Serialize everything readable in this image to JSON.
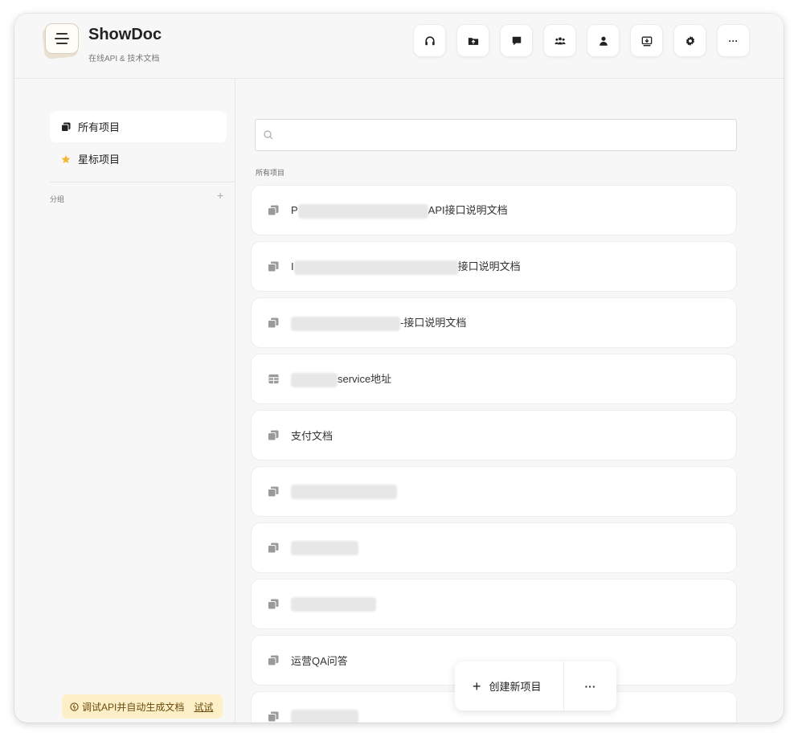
{
  "app": {
    "title": "ShowDoc",
    "subtitle": "在线API & 技术文档"
  },
  "toolbar": {
    "buttons": [
      {
        "name": "support-button",
        "icon": "headset-icon"
      },
      {
        "name": "import-button",
        "icon": "folder-upload-icon"
      },
      {
        "name": "message-button",
        "icon": "chat-icon"
      },
      {
        "name": "team-button",
        "icon": "team-icon"
      },
      {
        "name": "user-button",
        "icon": "user-icon"
      },
      {
        "name": "client-download-button",
        "icon": "download-box-icon"
      },
      {
        "name": "settings-button",
        "icon": "gear-icon"
      },
      {
        "name": "more-button",
        "icon": "ellipsis-icon"
      }
    ],
    "more_glyph": "···"
  },
  "sidebar": {
    "all_projects": "所有项目",
    "starred_projects": "星标项目",
    "group_label": "分组",
    "add_group": "+",
    "promo_text": "调试API并自动生成文档",
    "promo_link": "试试"
  },
  "search": {
    "placeholder": "",
    "value": ""
  },
  "list_label": "所有项目",
  "projects": [
    {
      "prefix": "P",
      "suffix": "API接口说明文档",
      "icon": "doc-stack-icon"
    },
    {
      "prefix": "I",
      "suffix": "接口说明文档",
      "icon": "doc-stack-icon"
    },
    {
      "prefix": "",
      "suffix": "-接口说明文档",
      "icon": "doc-stack-icon"
    },
    {
      "prefix": "",
      "suffix": "service地址",
      "icon": "table-icon"
    },
    {
      "prefix": "",
      "suffix": "支付文档",
      "icon": "doc-stack-icon"
    },
    {
      "prefix": "",
      "suffix": "",
      "icon": "doc-stack-icon"
    },
    {
      "prefix": "",
      "suffix": "",
      "icon": "doc-stack-icon"
    },
    {
      "prefix": "",
      "suffix": "",
      "icon": "doc-stack-icon"
    },
    {
      "prefix": "",
      "suffix": "运营QA问答",
      "icon": "doc-stack-icon"
    },
    {
      "prefix": "",
      "suffix": "",
      "icon": "doc-stack-icon"
    }
  ],
  "fab": {
    "create_label": "创建新项目",
    "plus": "+",
    "more": "···"
  },
  "colors": {
    "window_bg": "#f7f7f7",
    "card_bg": "#ffffff",
    "star": "#f5b731",
    "promo_bg": "#fdf0c8"
  }
}
